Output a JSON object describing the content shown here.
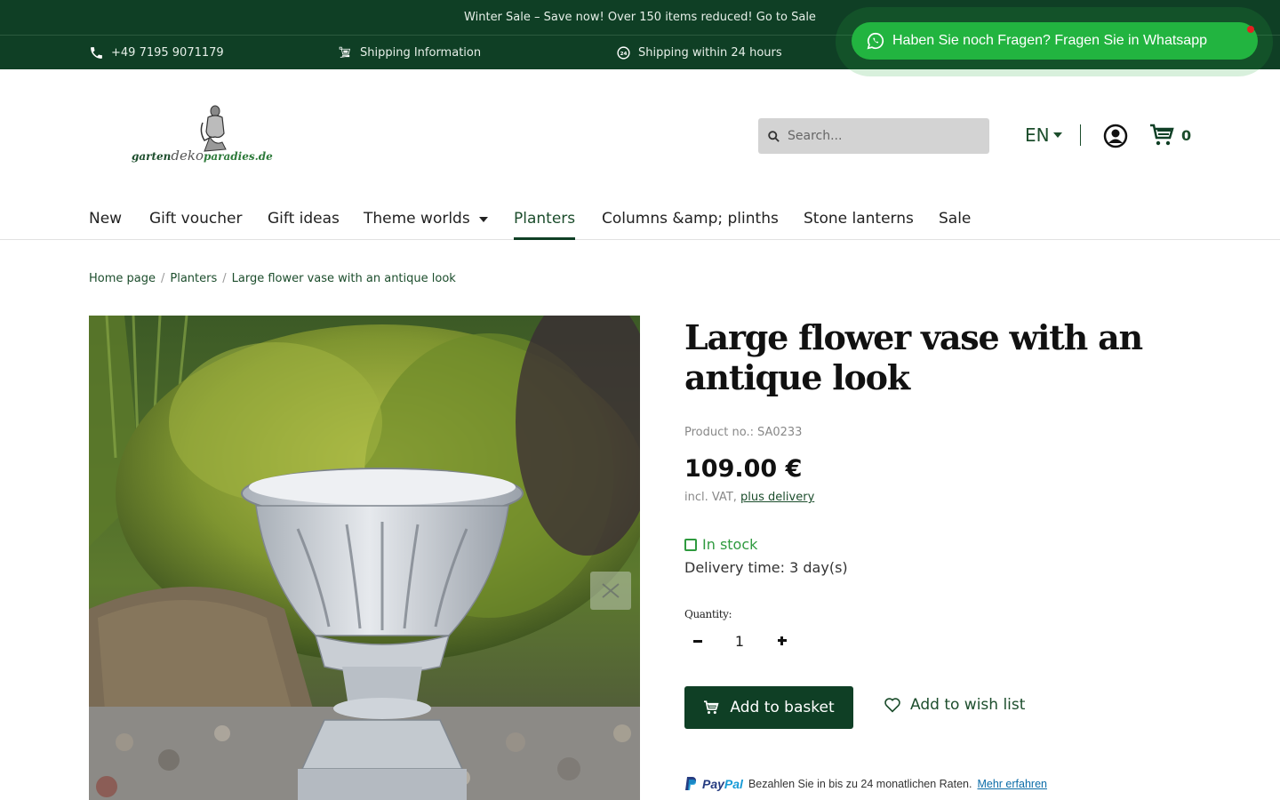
{
  "top_banner": {
    "text": "Winter Sale – Save now! Over 150 items reduced! Go to Sale"
  },
  "usp_bar": {
    "phone": "+49 7195 9071179",
    "shipping_info": "Shipping Information",
    "shipping_24h": "Shipping within 24 hours"
  },
  "whatsapp": {
    "label": "Haben Sie noch Fragen? Fragen Sie in Whatsapp"
  },
  "logo": {
    "part1": "garten",
    "part2": "deko",
    "part3": "paradies.de"
  },
  "search": {
    "placeholder": "Search..."
  },
  "language": {
    "current": "EN"
  },
  "cart": {
    "count": "0"
  },
  "nav": {
    "items": [
      {
        "label": "New"
      },
      {
        "label": "Gift voucher"
      },
      {
        "label": "Gift ideas"
      },
      {
        "label": "Theme worlds"
      },
      {
        "label": "Planters"
      },
      {
        "label": "Columns &amp; plinths"
      },
      {
        "label": "Stone lanterns"
      },
      {
        "label": "Sale"
      }
    ],
    "active": "Planters"
  },
  "breadcrumb": {
    "items": [
      "Home page",
      "Planters",
      "Large flower vase with an antique look"
    ],
    "separator": "/"
  },
  "product": {
    "title": "Large flower vase with an antique look",
    "number_label": "Product no.:",
    "number": "SA0233",
    "price": "109.00 €",
    "vat_prefix": "incl. VAT,",
    "vat_link": "plus delivery",
    "stock": "In stock",
    "delivery_time": "Delivery time: 3 day(s)",
    "quantity_label": "Quantity:",
    "quantity": "1",
    "add_to_basket": "Add to basket",
    "add_to_wishlist": "Add to wish list"
  },
  "paypal": {
    "logo_pay": "Pay",
    "logo_pal": "Pal",
    "text": "Bezahlen Sie in bis zu 24 monatlichen Raten.",
    "link": "Mehr erfahren"
  },
  "colors": {
    "brand_dark_green": "#0f3f25",
    "whatsapp_green": "#22b440",
    "stock_green": "#2f9a3f"
  }
}
